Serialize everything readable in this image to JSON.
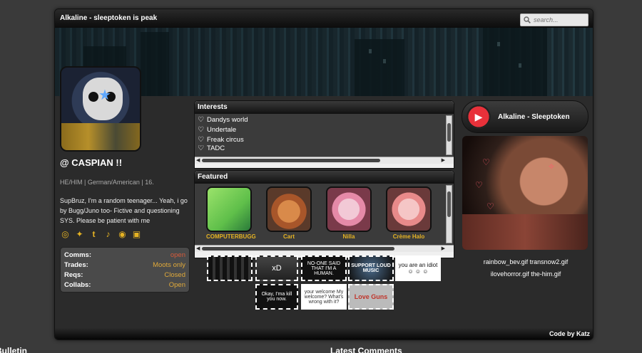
{
  "header": {
    "title": "Alkaline - sleeptoken is peak",
    "search_placeholder": "search..."
  },
  "profile": {
    "name": "@ CASPIAN !!",
    "pronouns": "HE/HIM | German/American | 16.",
    "bio": "SupBruz, I'm a random teenager... Yeah, i go by Bugg/Juno too- Fictive and questioning SYS. Please be patient with me",
    "socials": [
      "instagram-icon",
      "twitter-icon",
      "tumblr-icon",
      "tiktok-icon",
      "discord-icon",
      "card-icon"
    ],
    "status": [
      {
        "key": "Comms:",
        "value": "open"
      },
      {
        "key": "Trades:",
        "value": "Moots only"
      },
      {
        "key": "Reqs:",
        "value": "Closed"
      },
      {
        "key": "Collabs:",
        "value": "Open"
      }
    ]
  },
  "interests": {
    "title": "Interests",
    "items": [
      "Dandys world",
      "Undertale",
      "Freak circus",
      "TADC"
    ]
  },
  "featured": {
    "title": "Featured",
    "items": [
      "COMPUTERBUGG",
      "Cart",
      "Nilla",
      "Crème Halo"
    ]
  },
  "stamps": [
    "",
    "xD",
    "NO-ONE SAID THAT I'M A HUMAN.",
    "SUPPORT LOUD MUSIC",
    "you are an idiot ☺ ☺ ☺",
    "Okay, I'ma kill you now.",
    "your welcome My welcome? What's wrong with it?",
    "Love Guns"
  ],
  "player": {
    "title": "Alkaline - Sleeptoken"
  },
  "gifs": {
    "line1": "rainbow_bev.gif transnow2.gif",
    "line2": "ilovehorror.gif the-him.gif"
  },
  "footer": {
    "credit": "Code by Katz"
  },
  "below": {
    "left": "Bulletin",
    "right": "Latest Comments"
  },
  "colors": {
    "accent": "#e6b323",
    "status_value": "#e0a93a",
    "status_open": "#d65a3a",
    "play": "#e8313a"
  }
}
